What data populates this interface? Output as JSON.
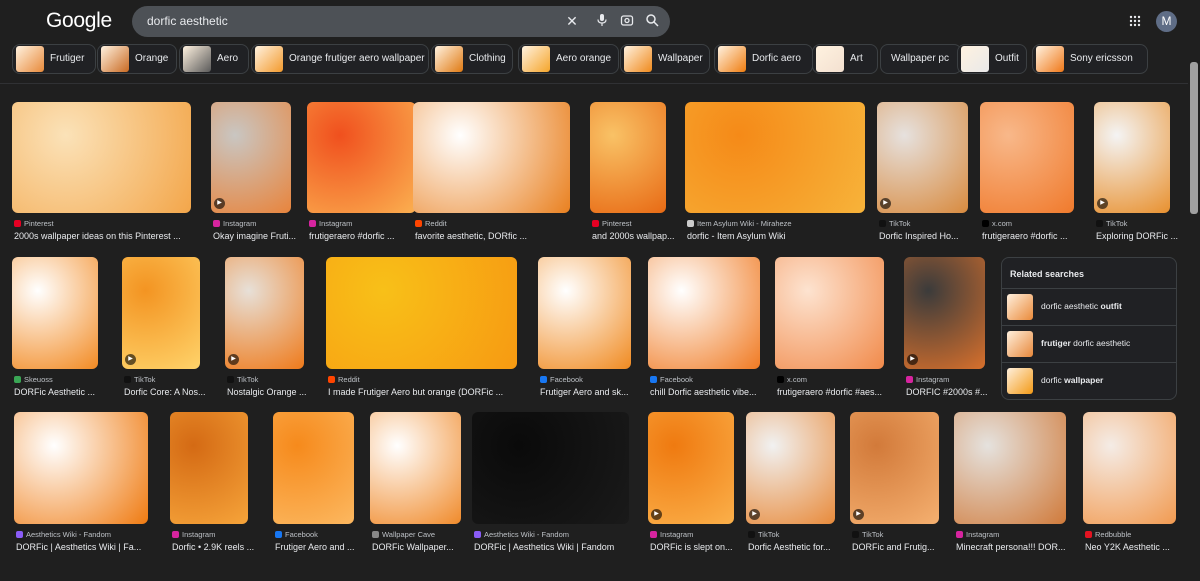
{
  "logo": "Google",
  "search": {
    "query": "dorfic aesthetic",
    "avatar_letter": "M"
  },
  "chips": [
    {
      "label": "Frutiger",
      "color": "#e88a3a"
    },
    {
      "label": "Orange",
      "color": "#c96a22"
    },
    {
      "label": "Aero",
      "color": "#5a5a5a"
    },
    {
      "label": "Orange frutiger aero wallpaper",
      "color": "#f39a2c"
    },
    {
      "label": "Clothing",
      "color": "#e07a12"
    },
    {
      "label": "Aero orange",
      "color": "#f5a52a"
    },
    {
      "label": "Wallpaper",
      "color": "#f08a1c"
    },
    {
      "label": "Dorfic aero",
      "color": "#ef7d10"
    },
    {
      "label": "Art",
      "color": "#f3e0d0"
    },
    {
      "label": "Wallpaper pc",
      "color": ""
    },
    {
      "label": "Outfit",
      "color": "#e9e9e9"
    },
    {
      "label": "Sony ericsson",
      "color": "#f07818"
    }
  ],
  "rows": [
    [
      {
        "source": "Pinterest",
        "title": "2000s wallpaper ideas on this Pinterest ...",
        "favicon": "#e60023",
        "colors": [
          "#fbe2b8",
          "#f3a64a"
        ],
        "video": false
      },
      {
        "source": "Instagram",
        "title": "Okay imagine Fruti...",
        "favicon": "#d6249f",
        "colors": [
          "#c9c6c2",
          "#e8843c"
        ],
        "video": true
      },
      {
        "source": "Instagram",
        "title": "frutigeraero #dorfic ...",
        "favicon": "#d6249f",
        "colors": [
          "#f0501e",
          "#fbb050"
        ],
        "video": false
      },
      {
        "source": "Reddit",
        "title": "favorite aesthetic, DORfic ...",
        "favicon": "#ff4500",
        "colors": [
          "#ffffff",
          "#e9801f"
        ],
        "video": false
      },
      {
        "source": "Pinterest",
        "title": "and 2000s wallpap...",
        "favicon": "#e60023",
        "colors": [
          "#f9c266",
          "#e86a14"
        ],
        "video": false
      },
      {
        "source": "Item Asylum Wiki - Miraheze",
        "title": "dorfic - Item Asylum Wiki",
        "favicon": "#cccccc",
        "colors": [
          "#f58a18",
          "#f7b33a"
        ],
        "video": false
      },
      {
        "source": "TikTok",
        "title": "Dorfic Inspired Ho...",
        "favicon": "#111111",
        "colors": [
          "#e6e1de",
          "#d88a3e"
        ],
        "video": true
      },
      {
        "source": "x.com",
        "title": "frutigeraero #dorfic ...",
        "favicon": "#000000",
        "colors": [
          "#f8b88a",
          "#f07a2c"
        ],
        "video": false
      },
      {
        "source": "TikTok",
        "title": "Exploring DORFic ...",
        "favicon": "#111111",
        "colors": [
          "#f4f4f4",
          "#e8902e"
        ],
        "video": true
      }
    ],
    [
      {
        "source": "Skeuoss",
        "title": "DORFic Aesthetic ...",
        "favicon": "#3aa655",
        "colors": [
          "#ffffff",
          "#f28a22"
        ],
        "video": false
      },
      {
        "source": "TikTok",
        "title": "Dorfic Core: A Nos...",
        "favicon": "#111111",
        "colors": [
          "#f39422",
          "#ffd36a"
        ],
        "video": true
      },
      {
        "source": "TikTok",
        "title": "Nostalgic Orange ...",
        "favicon": "#111111",
        "colors": [
          "#e7e0d8",
          "#ef7a1a"
        ],
        "video": true
      },
      {
        "source": "Reddit",
        "title": "I made Frutiger Aero but orange (DORFic ...",
        "favicon": "#ff4500",
        "colors": [
          "#f8c018",
          "#f79a12"
        ],
        "video": false
      },
      {
        "source": "Facebook",
        "title": "Frutiger Aero and sk...",
        "favicon": "#1877f2",
        "colors": [
          "#ffffff",
          "#f08a20"
        ],
        "video": false
      },
      {
        "source": "Facebook",
        "title": "chill Dorfic aesthetic vibe...",
        "favicon": "#1877f2",
        "colors": [
          "#ffffff",
          "#f07a22"
        ],
        "video": false
      },
      {
        "source": "x.com",
        "title": "frutigeraero #dorfic #aes...",
        "favicon": "#000000",
        "colors": [
          "#fde3d0",
          "#f18a4a"
        ],
        "video": false
      },
      {
        "source": "Instagram",
        "title": "DORFIC #2000s #...",
        "favicon": "#d6249f",
        "colors": [
          "#3b3b3b",
          "#d8702c"
        ],
        "video": true
      }
    ],
    [
      {
        "source": "Aesthetics Wiki - Fandom",
        "title": "DORFic | Aesthetics Wiki | Fa...",
        "favicon": "#8a5cf6",
        "colors": [
          "#ffffff",
          "#ef7a10"
        ],
        "video": false
      },
      {
        "source": "Instagram",
        "title": "Dorfic • 2.9K reels ...",
        "favicon": "#d6249f",
        "colors": [
          "#d46a14",
          "#f6a43a"
        ],
        "video": false
      },
      {
        "source": "Facebook",
        "title": "Frutiger Aero and ...",
        "favicon": "#1877f2",
        "colors": [
          "#f68a1c",
          "#fcb860"
        ],
        "video": false
      },
      {
        "source": "Wallpaper Cave",
        "title": "DORFic Wallpaper...",
        "favicon": "#888888",
        "colors": [
          "#ffffff",
          "#f08a2a"
        ],
        "video": false
      },
      {
        "source": "Aesthetics Wiki - Fandom",
        "title": "DORFic | Aesthetics Wiki | Fandom",
        "favicon": "#8a5cf6",
        "colors": [
          "#0a0a0a",
          "#1a1a1a"
        ],
        "video": false
      },
      {
        "source": "Instagram",
        "title": "DORFic is slept on...",
        "favicon": "#d6249f",
        "colors": [
          "#ef7a10",
          "#fbb04a"
        ],
        "video": true
      },
      {
        "source": "TikTok",
        "title": "Dorfic Aesthetic for...",
        "favicon": "#111111",
        "colors": [
          "#f1f1f1",
          "#e88a3a"
        ],
        "video": true
      },
      {
        "source": "TikTok",
        "title": "DORFic and Frutig...",
        "favicon": "#111111",
        "colors": [
          "#d27a3a",
          "#f5b070"
        ],
        "video": true
      },
      {
        "source": "Instagram",
        "title": "Minecraft persona!!! DOR...",
        "favicon": "#d6249f",
        "colors": [
          "#e5e2de",
          "#d07a3a"
        ],
        "video": false
      },
      {
        "source": "Redbubble",
        "title": "Neo Y2K Aesthetic ...",
        "favicon": "#e41321",
        "colors": [
          "#f4ece6",
          "#f29a50"
        ],
        "video": false
      }
    ]
  ],
  "related": {
    "heading": "Related searches",
    "items": [
      {
        "before": "dorfic aesthetic ",
        "bold": "outfit",
        "after": "",
        "color": "#ea8a3a"
      },
      {
        "before": "",
        "bold": "frutiger",
        "after": " dorfic aesthetic",
        "color": "#e8883a"
      },
      {
        "before": "dorfic ",
        "bold": "wallpaper",
        "after": "",
        "color": "#f39a16"
      }
    ]
  }
}
